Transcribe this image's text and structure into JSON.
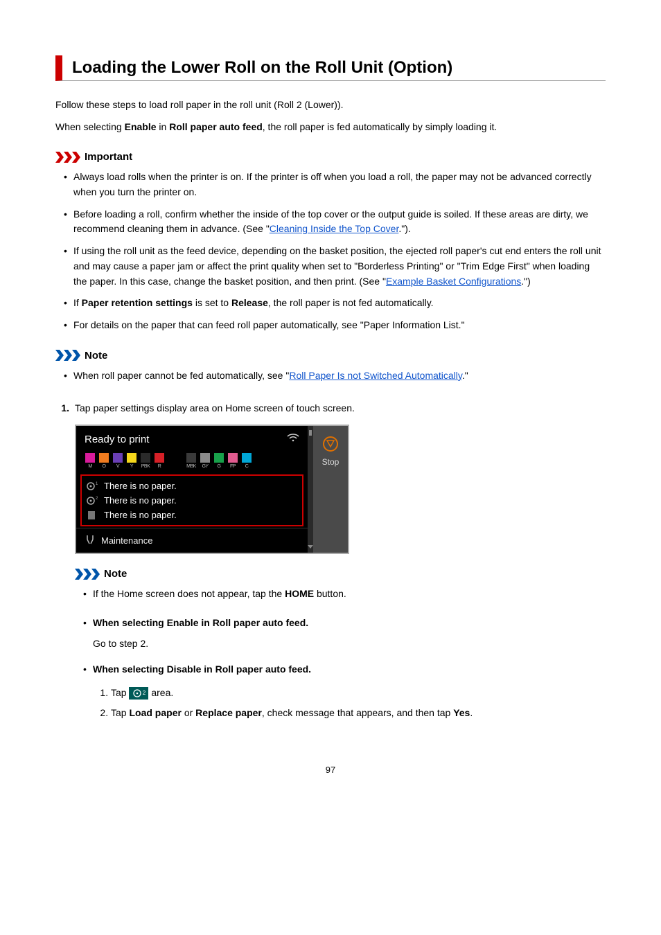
{
  "title": "Loading the Lower Roll on the Roll Unit (Option)",
  "intro1": "Follow these steps to load roll paper in the roll unit (Roll 2 (Lower)).",
  "intro2_pre": "When selecting ",
  "intro2_b1": "Enable",
  "intro2_mid": " in ",
  "intro2_b2": "Roll paper auto feed",
  "intro2_post": ", the roll paper is fed automatically by simply loading it.",
  "important_label": "Important",
  "important": {
    "i1": "Always load rolls when the printer is on. If the printer is off when you load a roll, the paper may not be advanced correctly when you turn the printer on.",
    "i2_pre": "Before loading a roll, confirm whether the inside of the top cover or the output guide is soiled. If these areas are dirty, we recommend cleaning them in advance. (See \"",
    "i2_link": "Cleaning Inside the Top Cover",
    "i2_post": ".\").",
    "i3_pre": "If using the roll unit as the feed device, depending on the basket position, the ejected roll paper's cut end enters the roll unit and may cause a paper jam or affect the print quality when set to \"Borderless Printing\" or \"Trim Edge First\" when loading the paper. In this case, change the basket position, and then print. (See \"",
    "i3_link": "Example Basket Configurations",
    "i3_post": ".\")",
    "i4_pre": "If ",
    "i4_b1": "Paper retention settings",
    "i4_mid": " is set to ",
    "i4_b2": "Release",
    "i4_post": ", the roll paper is not fed automatically.",
    "i5": "For details on the paper that can feed roll paper automatically, see \"Paper Information List.\""
  },
  "note_label": "Note",
  "note1_pre": "When roll paper cannot be fed automatically, see \"",
  "note1_link": "Roll Paper Is not Switched Automatically",
  "note1_post": ".\"",
  "step1_num": "1.",
  "step1_text": "Tap paper settings display area on Home screen of touch screen.",
  "ui": {
    "ready": "Ready to print",
    "inks": [
      {
        "lbl": "M",
        "color": "#d81b9b"
      },
      {
        "lbl": "O",
        "color": "#ef7b1f"
      },
      {
        "lbl": "V",
        "color": "#6a3fb5"
      },
      {
        "lbl": "Y",
        "color": "#f5d71b"
      },
      {
        "lbl": "PBK",
        "color": "#2a2a2a"
      },
      {
        "lbl": "R",
        "color": "#d62027"
      }
    ],
    "inks2": [
      {
        "lbl": "MBK",
        "color": "#3a3a3a"
      },
      {
        "lbl": "GY",
        "color": "#8a8a8a"
      },
      {
        "lbl": "G",
        "color": "#18a04a"
      },
      {
        "lbl": "FP",
        "color": "#e05b8f"
      },
      {
        "lbl": "C",
        "color": "#00a6d6"
      }
    ],
    "paper1": "There is no paper.",
    "paper2": "There is no paper.",
    "paper3": "There is no paper.",
    "maintenance": "Maintenance",
    "stop": "Stop"
  },
  "note2_pre": "If the Home screen does not appear, tap the ",
  "note2_b": "HOME",
  "note2_post": " button.",
  "sub_enable": "When selecting Enable in Roll paper auto feed.",
  "sub_enable_body": "Go to step 2.",
  "sub_disable": "When selecting Disable in Roll paper auto feed.",
  "sub_d1_pre": "Tap ",
  "sub_d1_post": " area.",
  "sub_d2_pre": "Tap ",
  "sub_d2_b1": "Load paper",
  "sub_d2_mid1": " or ",
  "sub_d2_b2": "Replace paper",
  "sub_d2_mid2": ", check message that appears, and then tap ",
  "sub_d2_b3": "Yes",
  "sub_d2_post": ".",
  "page_num": "97"
}
